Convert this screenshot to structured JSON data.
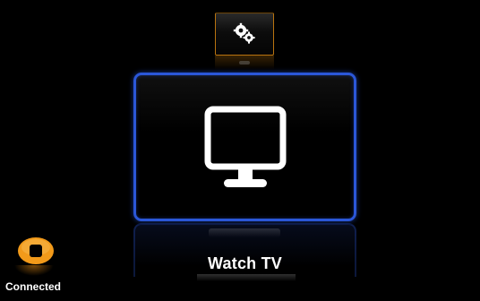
{
  "menu": {
    "top_item": {
      "icon": "gears-icon"
    },
    "selected_item": {
      "label": "Watch TV",
      "icon": "monitor-icon"
    }
  },
  "status": {
    "label": "Connected",
    "icon": "stop-circle-icon"
  },
  "colors": {
    "background": "#000000",
    "selection_border": "#2b57d8",
    "top_tile_border": "#b8730f",
    "status_icon": "#f29a1a"
  }
}
